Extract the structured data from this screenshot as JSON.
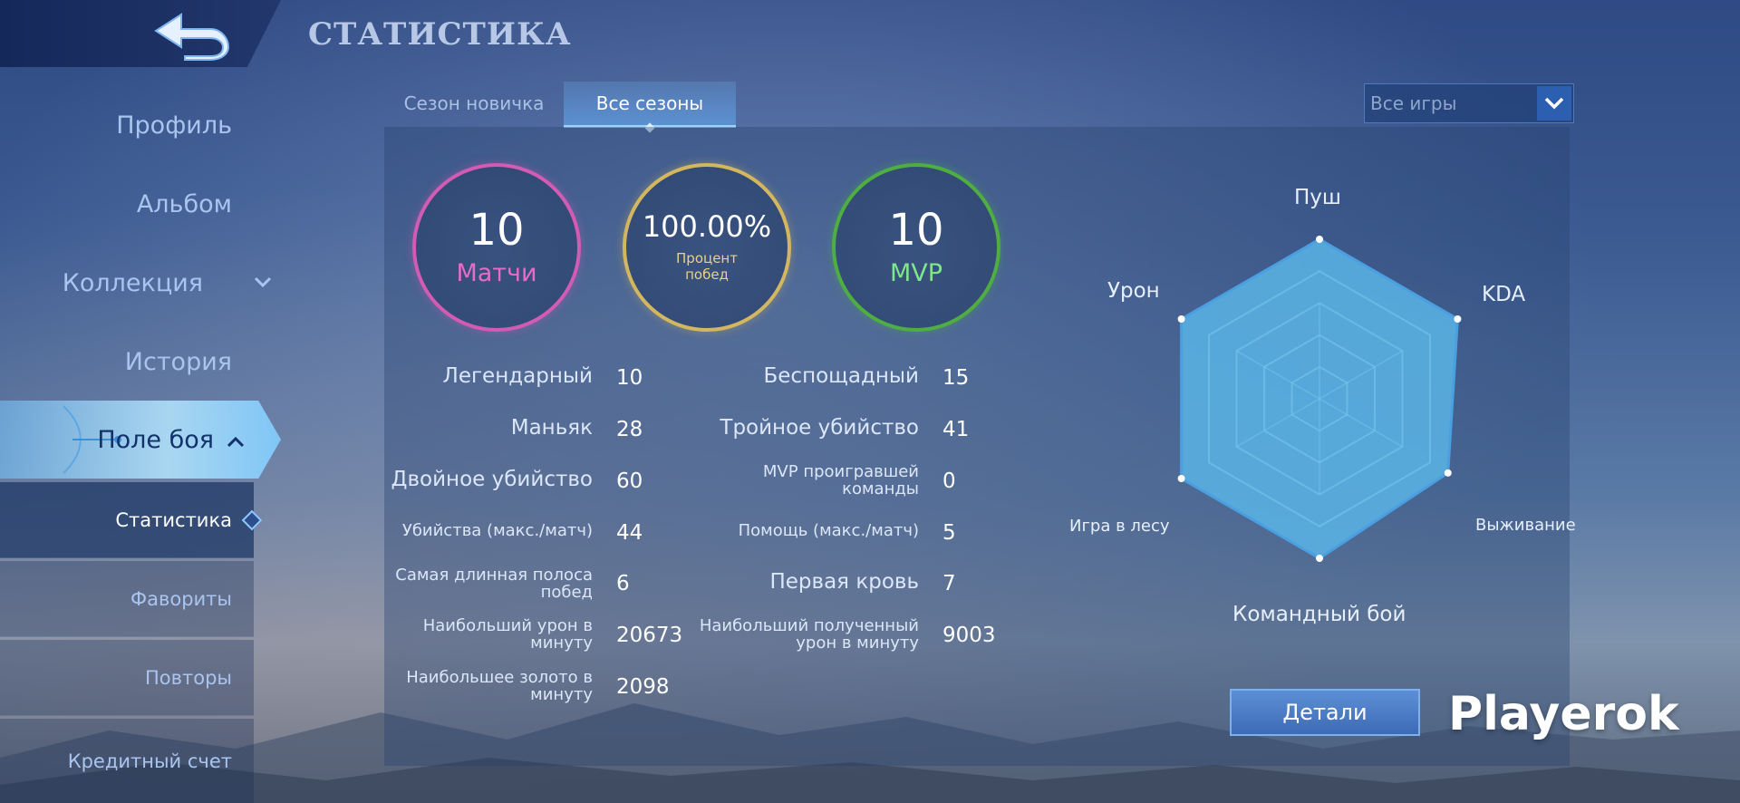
{
  "header": {
    "title": "СТАТИСТИКА"
  },
  "sidebar": {
    "items": [
      {
        "label": "Профиль"
      },
      {
        "label": "Альбом"
      },
      {
        "label": "Коллекция"
      },
      {
        "label": "История"
      },
      {
        "label": "Поле боя"
      }
    ],
    "sub_items": [
      {
        "label": "Статистика"
      },
      {
        "label": "Фавориты"
      },
      {
        "label": "Повторы"
      },
      {
        "label": "Кредитный счет"
      }
    ]
  },
  "tabs": [
    {
      "label": "Сезон новичка"
    },
    {
      "label": "Все сезоны"
    }
  ],
  "filter": {
    "label": "Все игры"
  },
  "summary": {
    "matches": {
      "value": "10",
      "label": "Матчи"
    },
    "win_rate": {
      "value": "100.00%",
      "label_line1": "Процент",
      "label_line2": "побед"
    },
    "mvp": {
      "value": "10",
      "label": "MVP"
    }
  },
  "stats_left": [
    {
      "label_line1": "Легендарный",
      "label_line2": "",
      "value": "10"
    },
    {
      "label_line1": "Маньяк",
      "label_line2": "",
      "value": "28"
    },
    {
      "label_line1": "Двойное убийство",
      "label_line2": "",
      "value": "60"
    },
    {
      "label_line1": "Убийства (макс./матч)",
      "label_line2": "",
      "value": "44"
    },
    {
      "label_line1": "Самая длинная полоса",
      "label_line2": "побед",
      "value": "6"
    },
    {
      "label_line1": "Наибольший урон в",
      "label_line2": "минуту",
      "value": "20673"
    },
    {
      "label_line1": "Наибольшее золото в",
      "label_line2": "минуту",
      "value": "2098"
    }
  ],
  "stats_right": [
    {
      "label_line1": "Беспощадный",
      "label_line2": "",
      "value": "15"
    },
    {
      "label_line1": "Тройное убийство",
      "label_line2": "",
      "value": "41"
    },
    {
      "label_line1": "MVP проигравшей",
      "label_line2": "команды",
      "value": "0"
    },
    {
      "label_line1": "Помощь (макс./матч)",
      "label_line2": "",
      "value": "5"
    },
    {
      "label_line1": "Первая кровь",
      "label_line2": "",
      "value": "7"
    },
    {
      "label_line1": "Наибольший полученный",
      "label_line2": "урон в минуту",
      "value": "9003"
    }
  ],
  "radar": {
    "axes": [
      "Пуш",
      "KDA",
      "Выживание",
      "Командный бой",
      "Игра в лесу",
      "Урон"
    ],
    "values": [
      1.0,
      1.0,
      0.93,
      1.0,
      1.0,
      1.0
    ],
    "colors": {
      "fill": "#5bb5e6",
      "stroke": "#4a9fe0",
      "grid": "#7cc6ee"
    }
  },
  "details_button": {
    "label": "Детали"
  },
  "watermark": {
    "text": "Playerok"
  }
}
